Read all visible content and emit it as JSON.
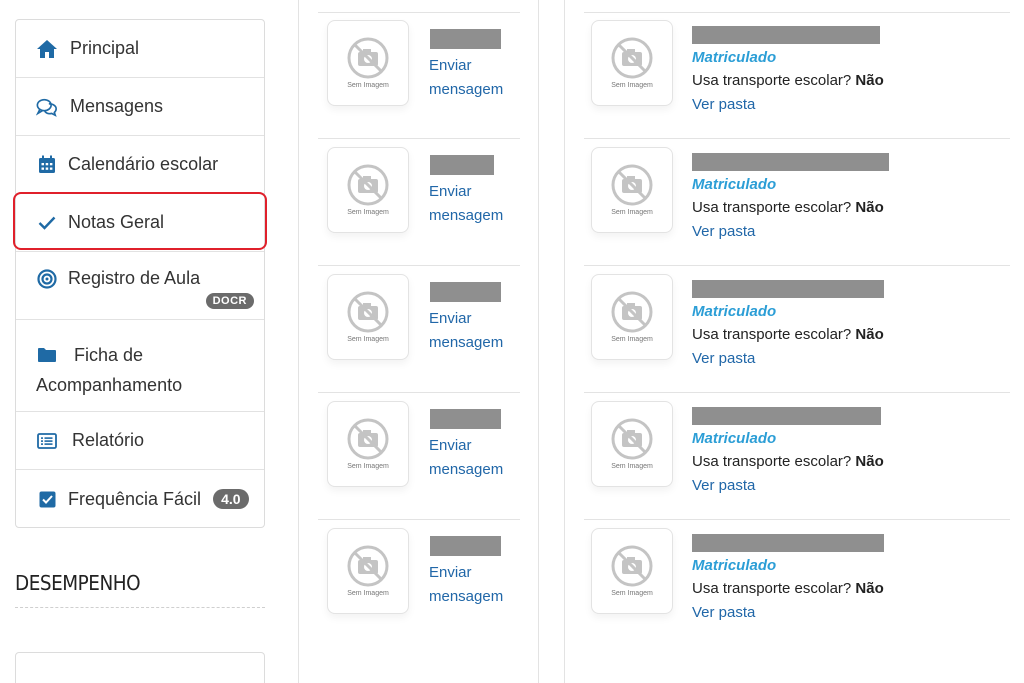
{
  "sidebar": {
    "items": [
      {
        "label": "Principal",
        "icon": "home-icon"
      },
      {
        "label": "Mensagens",
        "icon": "chat-icon"
      },
      {
        "label": "Calendário escolar",
        "icon": "calendar-icon"
      },
      {
        "label": "Notas Geral",
        "icon": "check-icon",
        "selected": true
      },
      {
        "label": "Registro de Aula",
        "icon": "target-icon",
        "badge": "DOCR"
      },
      {
        "label_line1": "Ficha de",
        "label_line2": "Acompanhamento",
        "icon": "folder-icon"
      },
      {
        "label": "Relatório",
        "icon": "list-icon"
      },
      {
        "label": "Frequência Fácil",
        "icon": "checkbox-icon",
        "badge": "4.0"
      }
    ]
  },
  "section": {
    "title": "DESEMPENHO"
  },
  "colors": {
    "accent_blue": "#2167a8",
    "status_blue": "#2c9ed6",
    "selected_border": "#e0202b",
    "icon_blue": "#1f6aa5"
  },
  "no_image_caption": "Sem Imagem",
  "middle": {
    "rows": [
      {
        "link_line1": "Enviar",
        "link_line2": "mensagem"
      },
      {
        "link_line1": "Enviar",
        "link_line2": "mensagem"
      },
      {
        "link_line1": "Enviar",
        "link_line2": "mensagem"
      },
      {
        "link_line1": "Enviar",
        "link_line2": "mensagem"
      },
      {
        "link_line1": "Enviar",
        "link_line2": "mensagem"
      }
    ]
  },
  "students": {
    "rows": [
      {
        "status": "Matriculado",
        "transport_label": "Usa transporte escolar?",
        "transport_value": "Não",
        "link": "Ver pasta"
      },
      {
        "status": "Matriculado",
        "transport_label": "Usa transporte escolar?",
        "transport_value": "Não",
        "link": "Ver pasta"
      },
      {
        "status": "Matriculado",
        "transport_label": "Usa transporte escolar?",
        "transport_value": "Não",
        "link": "Ver pasta"
      },
      {
        "status": "Matriculado",
        "transport_label": "Usa transporte escolar?",
        "transport_value": "Não",
        "link": "Ver pasta"
      },
      {
        "status": "Matriculado",
        "transport_label": "Usa transporte escolar?",
        "transport_value": "Não",
        "link": "Ver pasta"
      }
    ]
  }
}
